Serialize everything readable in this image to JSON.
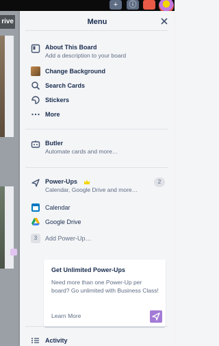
{
  "board": {
    "tab_label": "rive"
  },
  "header": {
    "add_glyph": "+",
    "info_glyph": "ⓘ",
    "notify_glyph": "🔔"
  },
  "menu": {
    "title": "Menu",
    "items": [
      {
        "label": "About This Board",
        "sub": "Add a description to your board",
        "icon": "board-icon"
      },
      {
        "label": "Change Background",
        "icon": "background-thumbnail-icon"
      },
      {
        "label": "Search Cards",
        "icon": "search-icon"
      },
      {
        "label": "Stickers",
        "icon": "sticker-icon"
      },
      {
        "label": "More",
        "icon": "more-dots-icon"
      }
    ],
    "butler": {
      "label": "Butler",
      "sub": "Automate cards and more…",
      "icon": "butler-icon"
    },
    "powerups": {
      "label": "Power-Ups",
      "sub": "Calendar, Google Drive and more…",
      "count": "2",
      "icon": "rocket-icon",
      "items": [
        {
          "label": "Calendar",
          "icon": "calendar-icon"
        },
        {
          "label": "Google Drive",
          "icon": "google-drive-icon"
        }
      ],
      "add": {
        "count": "3",
        "label": "Add Power-Up…"
      }
    },
    "promo": {
      "title": "Get Unlimited Power-Ups",
      "body": "Need more than one Power-Up per board? Go unlimited with Business Class!",
      "link": "Learn More"
    },
    "activity": {
      "label": "Activity",
      "icon": "activity-icon"
    }
  },
  "colors": {
    "accent_purple": "#a37bd6",
    "crown": "#f2d600",
    "notify": "#eb5a46"
  }
}
